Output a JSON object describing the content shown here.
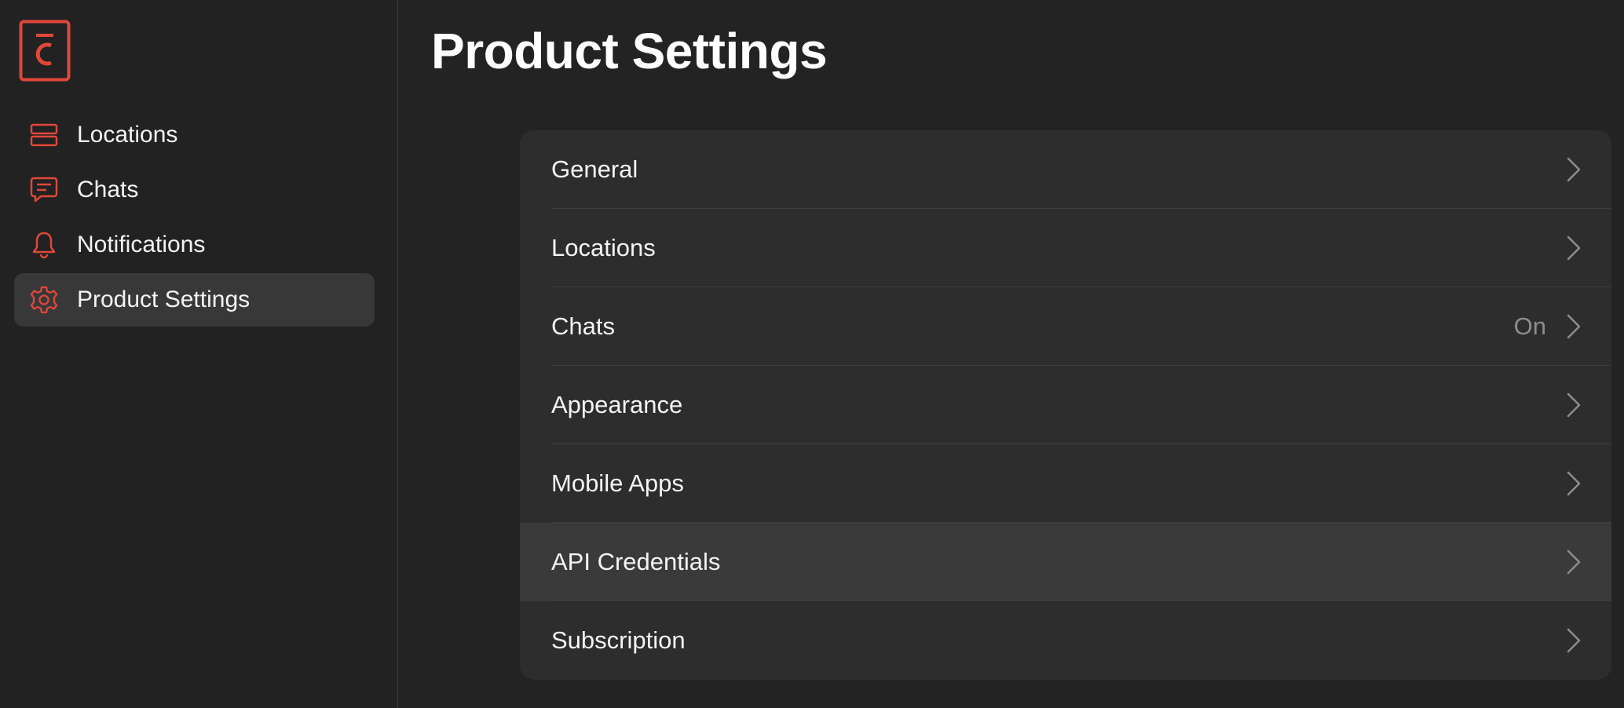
{
  "colors": {
    "accent": "#e0473a",
    "background": "#232323",
    "panel": "#2d2d2d",
    "active_item": "#383838",
    "hover_row": "#3a3a3a",
    "secondary_text": "#8d8d8d"
  },
  "sidebar": {
    "logo_icon": "app-logo-icon",
    "items": [
      {
        "label": "Locations",
        "icon": "locations-icon",
        "active": false
      },
      {
        "label": "Chats",
        "icon": "chat-bubble-icon",
        "active": false
      },
      {
        "label": "Notifications",
        "icon": "bell-icon",
        "active": false
      },
      {
        "label": "Product Settings",
        "icon": "gear-icon",
        "active": true
      }
    ]
  },
  "main": {
    "title": "Product Settings",
    "rows": [
      {
        "label": "General",
        "value": ""
      },
      {
        "label": "Locations",
        "value": ""
      },
      {
        "label": "Chats",
        "value": "On"
      },
      {
        "label": "Appearance",
        "value": ""
      },
      {
        "label": "Mobile Apps",
        "value": ""
      },
      {
        "label": "API Credentials",
        "value": "",
        "hovered": true
      },
      {
        "label": "Subscription",
        "value": ""
      }
    ]
  }
}
